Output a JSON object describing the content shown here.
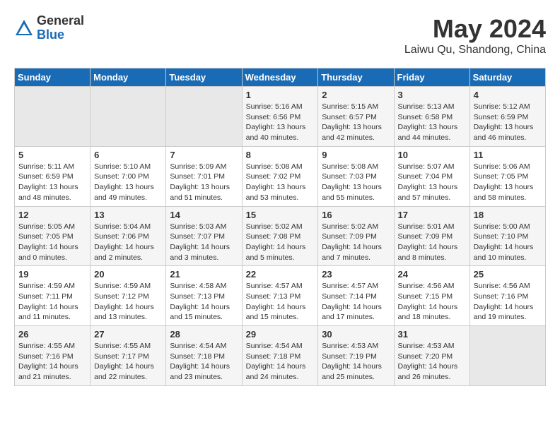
{
  "header": {
    "logo_general": "General",
    "logo_blue": "Blue",
    "month": "May 2024",
    "location": "Laiwu Qu, Shandong, China"
  },
  "days_of_week": [
    "Sunday",
    "Monday",
    "Tuesday",
    "Wednesday",
    "Thursday",
    "Friday",
    "Saturday"
  ],
  "weeks": [
    [
      {
        "day": "",
        "info": ""
      },
      {
        "day": "",
        "info": ""
      },
      {
        "day": "",
        "info": ""
      },
      {
        "day": "1",
        "info": "Sunrise: 5:16 AM\nSunset: 6:56 PM\nDaylight: 13 hours\nand 40 minutes."
      },
      {
        "day": "2",
        "info": "Sunrise: 5:15 AM\nSunset: 6:57 PM\nDaylight: 13 hours\nand 42 minutes."
      },
      {
        "day": "3",
        "info": "Sunrise: 5:13 AM\nSunset: 6:58 PM\nDaylight: 13 hours\nand 44 minutes."
      },
      {
        "day": "4",
        "info": "Sunrise: 5:12 AM\nSunset: 6:59 PM\nDaylight: 13 hours\nand 46 minutes."
      }
    ],
    [
      {
        "day": "5",
        "info": "Sunrise: 5:11 AM\nSunset: 6:59 PM\nDaylight: 13 hours\nand 48 minutes."
      },
      {
        "day": "6",
        "info": "Sunrise: 5:10 AM\nSunset: 7:00 PM\nDaylight: 13 hours\nand 49 minutes."
      },
      {
        "day": "7",
        "info": "Sunrise: 5:09 AM\nSunset: 7:01 PM\nDaylight: 13 hours\nand 51 minutes."
      },
      {
        "day": "8",
        "info": "Sunrise: 5:08 AM\nSunset: 7:02 PM\nDaylight: 13 hours\nand 53 minutes."
      },
      {
        "day": "9",
        "info": "Sunrise: 5:08 AM\nSunset: 7:03 PM\nDaylight: 13 hours\nand 55 minutes."
      },
      {
        "day": "10",
        "info": "Sunrise: 5:07 AM\nSunset: 7:04 PM\nDaylight: 13 hours\nand 57 minutes."
      },
      {
        "day": "11",
        "info": "Sunrise: 5:06 AM\nSunset: 7:05 PM\nDaylight: 13 hours\nand 58 minutes."
      }
    ],
    [
      {
        "day": "12",
        "info": "Sunrise: 5:05 AM\nSunset: 7:05 PM\nDaylight: 14 hours\nand 0 minutes."
      },
      {
        "day": "13",
        "info": "Sunrise: 5:04 AM\nSunset: 7:06 PM\nDaylight: 14 hours\nand 2 minutes."
      },
      {
        "day": "14",
        "info": "Sunrise: 5:03 AM\nSunset: 7:07 PM\nDaylight: 14 hours\nand 3 minutes."
      },
      {
        "day": "15",
        "info": "Sunrise: 5:02 AM\nSunset: 7:08 PM\nDaylight: 14 hours\nand 5 minutes."
      },
      {
        "day": "16",
        "info": "Sunrise: 5:02 AM\nSunset: 7:09 PM\nDaylight: 14 hours\nand 7 minutes."
      },
      {
        "day": "17",
        "info": "Sunrise: 5:01 AM\nSunset: 7:09 PM\nDaylight: 14 hours\nand 8 minutes."
      },
      {
        "day": "18",
        "info": "Sunrise: 5:00 AM\nSunset: 7:10 PM\nDaylight: 14 hours\nand 10 minutes."
      }
    ],
    [
      {
        "day": "19",
        "info": "Sunrise: 4:59 AM\nSunset: 7:11 PM\nDaylight: 14 hours\nand 11 minutes."
      },
      {
        "day": "20",
        "info": "Sunrise: 4:59 AM\nSunset: 7:12 PM\nDaylight: 14 hours\nand 13 minutes."
      },
      {
        "day": "21",
        "info": "Sunrise: 4:58 AM\nSunset: 7:13 PM\nDaylight: 14 hours\nand 15 minutes."
      },
      {
        "day": "22",
        "info": "Sunrise: 4:57 AM\nSunset: 7:13 PM\nDaylight: 14 hours\nand 15 minutes."
      },
      {
        "day": "23",
        "info": "Sunrise: 4:57 AM\nSunset: 7:14 PM\nDaylight: 14 hours\nand 17 minutes."
      },
      {
        "day": "24",
        "info": "Sunrise: 4:56 AM\nSunset: 7:15 PM\nDaylight: 14 hours\nand 18 minutes."
      },
      {
        "day": "25",
        "info": "Sunrise: 4:56 AM\nSunset: 7:16 PM\nDaylight: 14 hours\nand 19 minutes."
      }
    ],
    [
      {
        "day": "26",
        "info": "Sunrise: 4:55 AM\nSunset: 7:16 PM\nDaylight: 14 hours\nand 21 minutes."
      },
      {
        "day": "27",
        "info": "Sunrise: 4:55 AM\nSunset: 7:17 PM\nDaylight: 14 hours\nand 22 minutes."
      },
      {
        "day": "28",
        "info": "Sunrise: 4:54 AM\nSunset: 7:18 PM\nDaylight: 14 hours\nand 23 minutes."
      },
      {
        "day": "29",
        "info": "Sunrise: 4:54 AM\nSunset: 7:18 PM\nDaylight: 14 hours\nand 24 minutes."
      },
      {
        "day": "30",
        "info": "Sunrise: 4:53 AM\nSunset: 7:19 PM\nDaylight: 14 hours\nand 25 minutes."
      },
      {
        "day": "31",
        "info": "Sunrise: 4:53 AM\nSunset: 7:20 PM\nDaylight: 14 hours\nand 26 minutes."
      },
      {
        "day": "",
        "info": ""
      }
    ]
  ]
}
